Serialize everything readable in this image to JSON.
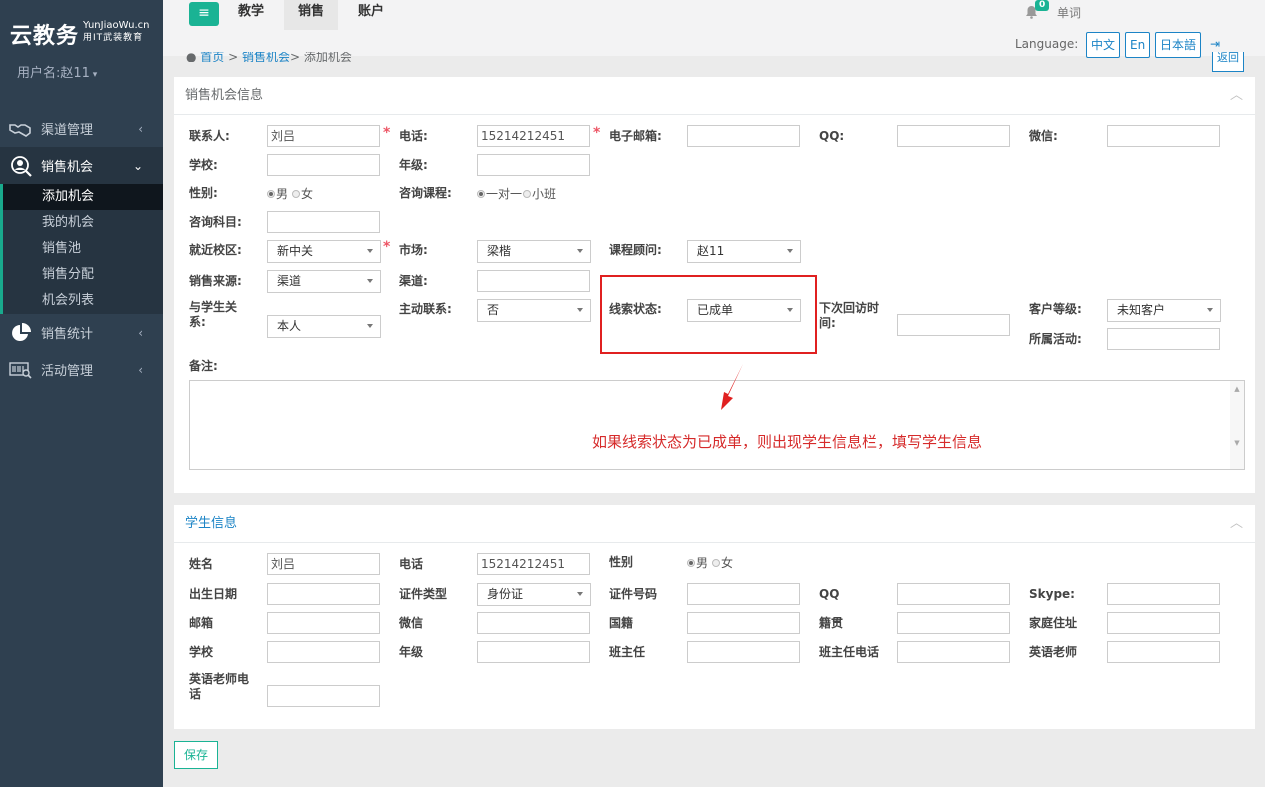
{
  "brand": {
    "name": "云教务",
    "site": "YunJiaoWu.cn",
    "slogan": "用IT武装教育"
  },
  "user": {
    "label": "用户名:赵11"
  },
  "nav": [
    {
      "label": "渠道管理",
      "icon": "handshake-icon"
    },
    {
      "label": "销售机会",
      "icon": "user-search-icon"
    },
    {
      "label": "销售统计",
      "icon": "pie-chart-icon"
    },
    {
      "label": "活动管理",
      "icon": "barcode-search-icon"
    }
  ],
  "subnav": [
    "添加机会",
    "我的机会",
    "销售池",
    "销售分配",
    "机会列表"
  ],
  "topbar": {
    "tabs": [
      "教学",
      "销售",
      "账户"
    ],
    "badge": "0",
    "dict": "单词",
    "language_label": "Language:",
    "langs": [
      "中文",
      "En",
      "日本語"
    ]
  },
  "breadcrumb": {
    "home": "首页",
    "mid": "销售机会",
    "current": "添加机会",
    "back": "返回"
  },
  "sales_panel": {
    "title": "销售机会信息",
    "labels": {
      "contact": "联系人:",
      "phone": "电话:",
      "email": "电子邮箱:",
      "qq": "QQ:",
      "wechat": "微信:",
      "school": "学校:",
      "grade": "年级:",
      "gender": "性别:",
      "course": "咨询课程:",
      "subject": "咨询科目:",
      "campus": "就近校区:",
      "market": "市场:",
      "advisor": "课程顾问:",
      "source": "销售来源:",
      "channel": "渠道:",
      "relation1": "与学生关",
      "relation2": "系:",
      "active": "主动联系:",
      "lead": "线索状态:",
      "next1": "下次回访时",
      "next2": "间:",
      "level": "客户等级:",
      "activity": "所属活动:",
      "remark": "备注:"
    },
    "values": {
      "contact": "刘吕",
      "phone": "15214212451",
      "campus": "新中关",
      "market": "梁楷",
      "advisor": "赵11",
      "source": "渠道",
      "relation": "本人",
      "active": "否",
      "lead": "已成单",
      "level": "未知客户"
    },
    "radios": {
      "male": "男",
      "female": "女",
      "one_on_one": "一对一",
      "small_class": "小班"
    }
  },
  "annotation": "如果线索状态为已成单，则出现学生信息栏，填写学生信息",
  "student_panel": {
    "title": "学生信息",
    "labels": {
      "name": "姓名",
      "phone": "电话",
      "gender": "性别",
      "birthday": "出生日期",
      "id_type": "证件类型",
      "id_no": "证件号码",
      "qq": "QQ",
      "skype": "Skype:",
      "email": "邮箱",
      "wechat": "微信",
      "nationality": "国籍",
      "native": "籍贯",
      "address": "家庭住址",
      "school": "学校",
      "grade": "年级",
      "head_teacher": "班主任",
      "head_phone": "班主任电话",
      "eng_teacher": "英语老师",
      "eng_phone1": "英语老师电",
      "eng_phone2": "话"
    },
    "values": {
      "name": "刘吕",
      "phone": "15214212451",
      "id_type": "身份证"
    },
    "radios": {
      "male": "男",
      "female": "女"
    }
  },
  "save": "保存"
}
